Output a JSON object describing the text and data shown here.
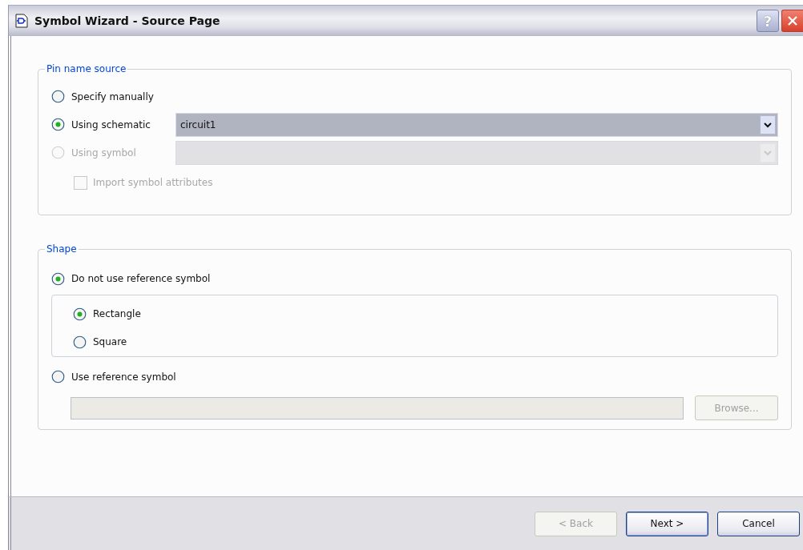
{
  "window": {
    "title": "Symbol Wizard - Source Page",
    "help_button": "?"
  },
  "pin_name_source": {
    "legend": "Pin name source",
    "options": [
      {
        "label": "Specify manually",
        "selected": false,
        "disabled": false
      },
      {
        "label": "Using schematic",
        "selected": true,
        "disabled": false,
        "dropdown": {
          "value": "circuit1",
          "disabled": false
        }
      },
      {
        "label": "Using symbol",
        "selected": false,
        "disabled": true,
        "dropdown": {
          "disabled": true
        }
      }
    ],
    "import_attributes": {
      "label": "Import symbol attributes",
      "checked": false,
      "disabled": true
    }
  },
  "shape": {
    "legend": "Shape",
    "options": [
      {
        "label": "Do not use reference symbol",
        "selected": true,
        "children": [
          {
            "label": "Rectangle",
            "selected": true
          },
          {
            "label": "Square",
            "selected": false
          }
        ]
      },
      {
        "label": "Use reference symbol",
        "selected": false,
        "path_field": {
          "disabled": true
        },
        "browse_button": {
          "label": "Browse...",
          "disabled": true
        }
      }
    ]
  },
  "buttons": [
    {
      "label": "< Back",
      "disabled": true,
      "default": false
    },
    {
      "label": "Next >",
      "disabled": false,
      "default": true
    },
    {
      "label": "Cancel",
      "disabled": false,
      "default": false
    }
  ]
}
